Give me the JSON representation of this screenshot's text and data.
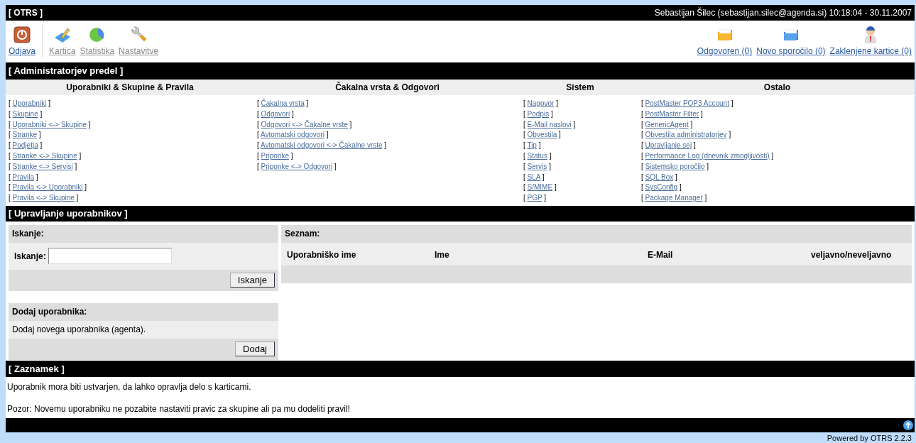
{
  "header": {
    "title": "[ OTRS ]",
    "user_info": "Sebastijan Šilec (sebastijan.silec@agenda.si) 10:18:04 - 30.11.2007"
  },
  "toolbar": {
    "left": [
      {
        "kind": "logout",
        "label": "Odjava"
      },
      {
        "kind": "ticket",
        "label": "Kartica"
      },
      {
        "kind": "stats",
        "label": "Statistika"
      },
      {
        "kind": "settings",
        "label": "Nastavitve"
      }
    ],
    "right": [
      {
        "kind": "answered",
        "label": "Odgovoren (0)"
      },
      {
        "kind": "new",
        "label": "Novo sporočilo (0)"
      },
      {
        "kind": "locked",
        "label": "Zaklenjene kartice (0)"
      }
    ]
  },
  "admin": {
    "title": "[ Administratorjev predel ]",
    "columns": [
      {
        "heading": "Uporabniki & Skupine & Pravila",
        "links": [
          {
            "open": "[",
            "label": "Uporabniki",
            "close": "]"
          },
          {
            "open": "[",
            "label": "Skupine",
            "close": "]"
          },
          {
            "open": "[",
            "label": "Uporabniki <-> Skupine",
            "close": "]"
          },
          {
            "open": "[",
            "label": "Stranke",
            "close": "]"
          },
          {
            "open": "[",
            "label": "Podjetja",
            "close": "]"
          },
          {
            "open": "[",
            "label": "Stranke <-> Skupine",
            "close": "]"
          },
          {
            "open": "[",
            "label": "Stranke <-> Servisi",
            "close": "]"
          },
          {
            "open": "[",
            "label": "Pravila",
            "close": "]"
          },
          {
            "open": "[",
            "label": "Pravila <-> Uporabniki",
            "close": "]"
          },
          {
            "open": "[",
            "label": "Pravila <-> Skupine",
            "close": "]"
          }
        ]
      },
      {
        "heading": "Čakalna vrsta & Odgovori",
        "links": [
          {
            "open": "[",
            "label": "Čakalna vrsta",
            "close": "]"
          },
          {
            "open": "[",
            "label": "Odgovori",
            "close": "]"
          },
          {
            "open": "[",
            "label": "Odgovori <-> Čakalne vrste",
            "close": "]"
          },
          {
            "open": "[",
            "label": "Avtomatski odgovori",
            "close": "]"
          },
          {
            "open": "[",
            "label": "Avtomatski odgovori <-> Čakalne vrste",
            "close": "]"
          },
          {
            "open": "[",
            "label": "Priponke",
            "close": "]"
          },
          {
            "open": "[",
            "label": "Priponke <-> Odgovori",
            "close": "]"
          }
        ]
      },
      {
        "heading": "Sistem",
        "links": [
          {
            "open": "[",
            "label": "Nagovor",
            "close": "]"
          },
          {
            "open": "[",
            "label": "Podpis",
            "close": "]"
          },
          {
            "open": "[",
            "label": "E-Mail naslovi",
            "close": "]"
          },
          {
            "open": "[",
            "label": "Obvestila",
            "close": "]"
          },
          {
            "open": "[",
            "label": "Tip",
            "close": "]"
          },
          {
            "open": "[",
            "label": "Status",
            "close": "]"
          },
          {
            "open": "[",
            "label": "Servis",
            "close": "]"
          },
          {
            "open": "[",
            "label": "SLA",
            "close": "]"
          },
          {
            "open": "[",
            "label": "S/MIME",
            "close": "]"
          },
          {
            "open": "[",
            "label": "PGP",
            "close": "]"
          }
        ]
      },
      {
        "heading": "Ostalo",
        "links": [
          {
            "open": "[",
            "label": "PostMaster POP3 Account",
            "close": "]"
          },
          {
            "open": "[",
            "label": "PostMaster Filter",
            "close": "]"
          },
          {
            "open": "[",
            "label": "GenericAgent",
            "close": "]"
          },
          {
            "open": "[",
            "label": "Obvestila administratorjev",
            "close": "]"
          },
          {
            "open": "[",
            "label": "Upravljanje sej",
            "close": "]"
          },
          {
            "open": "[",
            "label": "Performance Log (dnevnik zmogljivosti)",
            "close": "]"
          },
          {
            "open": "[",
            "label": "Sistemsko poročilo",
            "close": "]"
          },
          {
            "open": "[",
            "label": "SQL Box",
            "close": "]"
          },
          {
            "open": "[",
            "label": "SysConfig",
            "close": "]"
          },
          {
            "open": "[",
            "label": "Package Manager",
            "close": "]"
          }
        ]
      }
    ]
  },
  "user_management": {
    "title": "[ Upravljanje uporabnikov ]",
    "search": {
      "heading": "Iskanje:",
      "field_label": "Iskanje:",
      "button": "Iskanje"
    },
    "add": {
      "heading": "Dodaj uporabnika:",
      "text": "Dodaj novega uporabnika (agenta).",
      "button": "Dodaj"
    },
    "list": {
      "heading": "Seznam:",
      "columns": [
        "Uporabniško ime",
        "Ime",
        "E-Mail",
        "veljavno/neveljavno"
      ]
    }
  },
  "note": {
    "title": "[ Zaznamek ]",
    "paragraphs": [
      "Uporabnik mora biti ustvarjen, da lahko opravlja delo s karticami.",
      "Pozor: Novemu uporabniku ne pozabite nastaviti pravic za skupine ali pa mu dodeliti pravil!"
    ]
  },
  "footer": {
    "powered_by": "Powered by OTRS 2.2.3"
  }
}
